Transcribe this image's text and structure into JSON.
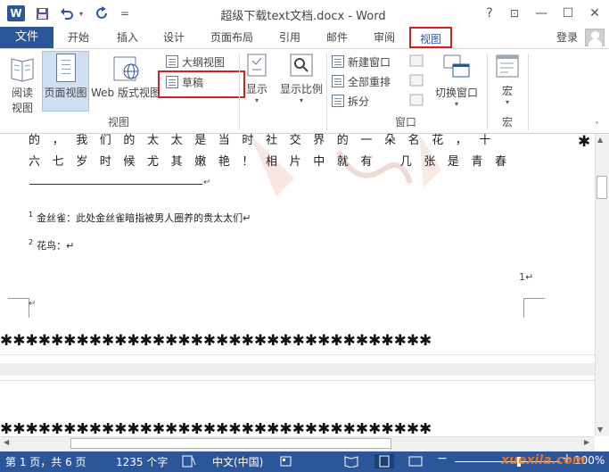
{
  "title_bar": {
    "app_logo": "W",
    "title": "超级下载text文档.docx - Word",
    "help": "?",
    "restore_ribbon": "⊡",
    "minimize": "—",
    "maximize": "☐",
    "close": "✕",
    "qat_customize": "="
  },
  "tabs": {
    "file": "文件",
    "home": "开始",
    "insert": "插入",
    "design": "设计",
    "layout": "页面布局",
    "references": "引用",
    "mailings": "邮件",
    "review": "审阅",
    "view": "视图",
    "login": "登录"
  },
  "ribbon": {
    "read_mode_1": "阅读",
    "read_mode_2": "视图",
    "page_view": "页面视图",
    "web_view": "Web 版式视图",
    "outline": "大纲视图",
    "draft": "草稿",
    "group_views": "视图",
    "show": "显示",
    "zoom": "显示比例",
    "new_window": "新建窗口",
    "arrange_all": "全部重排",
    "split": "拆分",
    "switch_windows": "切换窗口",
    "group_window": "窗口",
    "macros": "宏",
    "group_macros": "宏"
  },
  "document": {
    "line1": "的，我们的太太是当时社交界的一朵名花，十",
    "line2": "六七岁时候尤其嫩艳！相片中就有 几张是青春",
    "footnote1_num": "1",
    "footnote1": "金丝雀：此处金丝雀暗指被男人圈养的贵太太们↵",
    "footnote2_num": "2",
    "footnote2": "花鸟：↵",
    "page_number": "1↵",
    "para_mark": "↵",
    "star_row": "✱✱✱✱✱✱✱✱✱✱✱✱✱✱✱✱✱✱✱✱✱✱✱✱✱✱✱✱✱✱✱✱✱✱",
    "star_col": "✱ ✱ ✱ ✱ ✱ ✱ ✱ ✱ ✱ ✱ ✱ ✱"
  },
  "status_bar": {
    "page": "第 1 页，共 6 页",
    "words": "1235 个字",
    "language": "中文(中国)",
    "zoom": "100%",
    "zoom_minus": "−",
    "zoom_plus": "+",
    "watermark": "xuexila.com"
  },
  "colors": {
    "accent": "#2b579a",
    "highlight": "#d4201d"
  }
}
